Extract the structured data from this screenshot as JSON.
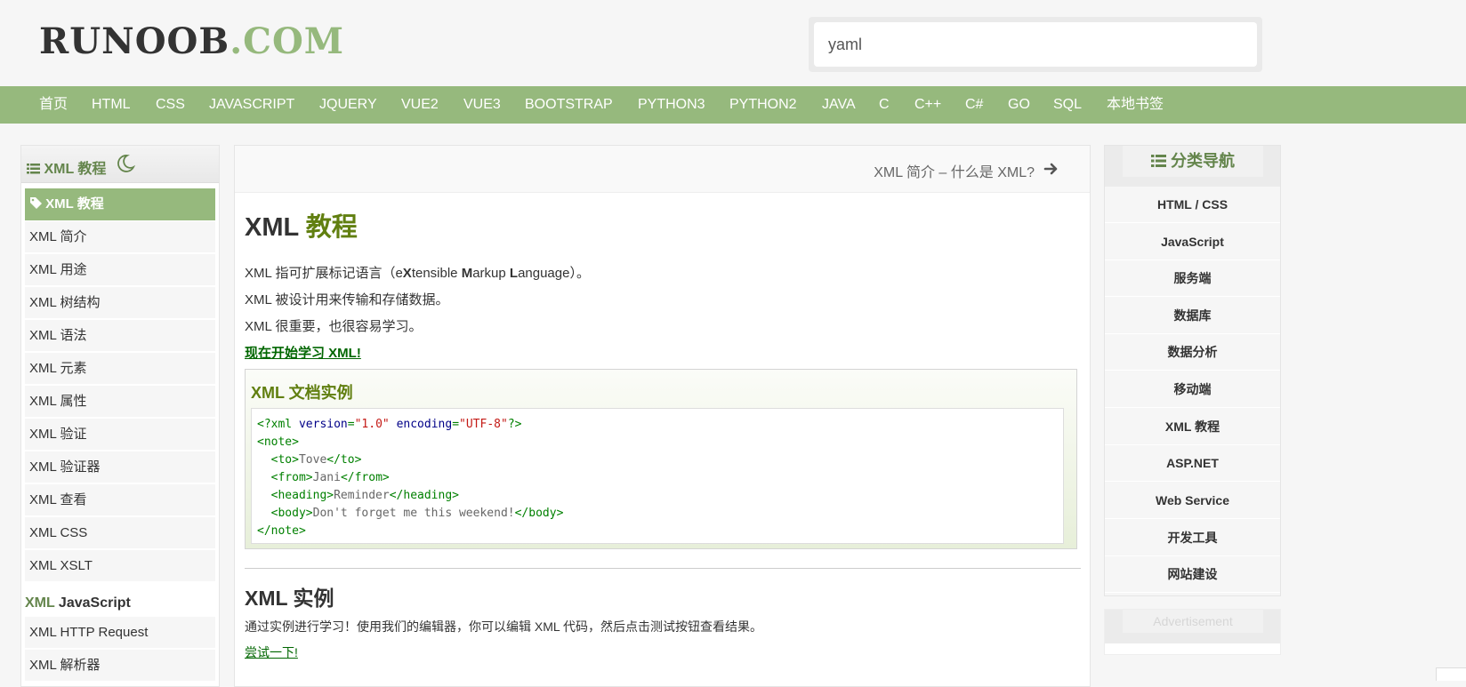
{
  "header": {
    "logo_part1": "RUNOOB",
    "logo_part2": ".COM",
    "search_value": "yaml"
  },
  "nav": [
    "首页",
    "HTML",
    "CSS",
    "JAVASCRIPT",
    "JQUERY",
    "VUE2",
    "VUE3",
    "BOOTSTRAP",
    "PYTHON3",
    "PYTHON2",
    "JAVA",
    "C",
    "C++",
    "C#",
    "GO",
    "SQL",
    "本地书签"
  ],
  "left": {
    "title": "XML 教程",
    "active": "XML 教程",
    "items": [
      "XML 简介",
      "XML 用途",
      "XML 树结构",
      "XML 语法",
      "XML 元素",
      "XML 属性",
      "XML 验证",
      "XML 验证器",
      "XML 查看",
      "XML CSS",
      "XML XSLT"
    ],
    "section_g": "XML",
    "section_rest": " JavaScript",
    "section_items": [
      "XML HTTP Request",
      "XML 解析器"
    ]
  },
  "main": {
    "next_label": "XML 简介 – 什么是 XML?",
    "title_a": "XML ",
    "title_b": "教程",
    "p1_a": "XML 指可扩展标记语言（e",
    "p1_b": "X",
    "p1_c": "tensible ",
    "p1_d": "M",
    "p1_e": "arkup ",
    "p1_f": "L",
    "p1_g": "anguage）。",
    "p2": "XML 被设计用来传输和存储数据。",
    "p3": "XML 很重要，也很容易学习。",
    "start_link": "现在开始学习 XML!",
    "example_title": "XML 文档实例",
    "code": {
      "l1_pi_open": "<?xml ",
      "l1_attr1": "version",
      "l1_eq1": "=",
      "l1_val1": "\"1.0\"",
      "l1_sp": " ",
      "l1_attr2": "encoding",
      "l1_eq2": "=",
      "l1_val2": "\"UTF-8\"",
      "l1_pi_close": "?>",
      "l2": "<note>",
      "l3_o": "  <to>",
      "l3_t": "Tove",
      "l3_c": "</to>",
      "l4_o": "  <from>",
      "l4_t": "Jani",
      "l4_c": "</from>",
      "l5_o": "  <heading>",
      "l5_t": "Reminder",
      "l5_c": "</heading>",
      "l6_o": "  <body>",
      "l6_t": "Don't forget me this weekend!",
      "l6_c": "</body>",
      "l7": "</note>"
    },
    "section2_title": "XML 实例",
    "section2_text": "通过实例进行学习！使用我们的编辑器，你可以编辑 XML 代码，然后点击测试按钮查看结果。",
    "try_link": "尝试一下! "
  },
  "right": {
    "title": "分类导航",
    "items": [
      "HTML / CSS",
      "JavaScript",
      "服务端",
      "数据库",
      "数据分析",
      "移动端",
      "XML 教程",
      "ASP.NET",
      "Web Service",
      "开发工具",
      "网站建设"
    ],
    "ad_label": "Advertisement"
  },
  "colors": {
    "brand_green": "#96b97d",
    "title_green": "#617f10",
    "link_green": "#006600"
  }
}
